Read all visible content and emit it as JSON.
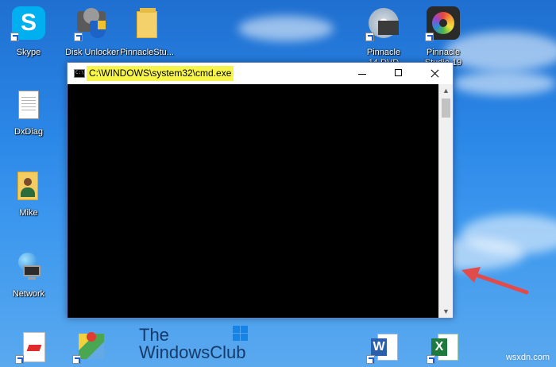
{
  "desktop": {
    "icons": [
      {
        "label": "Skype",
        "icon": "skype-icon"
      },
      {
        "label": "Disk Unlocker",
        "icon": "disk-unlocker-icon"
      },
      {
        "label": "PinnacleStu...",
        "icon": "folder-icon"
      },
      {
        "label": "Pinnacle\n14 DVD",
        "icon": "pinnacle-dvd-icon"
      },
      {
        "label": "Pinnacle\nStudio 19",
        "icon": "pinnacle-studio-icon"
      },
      {
        "label": "DxDiag",
        "icon": "document-icon"
      },
      {
        "label": "Mike",
        "icon": "user-folder-icon"
      },
      {
        "label": "Network",
        "icon": "network-icon"
      }
    ],
    "bottom_icons": [
      {
        "icon": "pdf-icon"
      },
      {
        "icon": "maps-icon"
      },
      {
        "icon": "word-icon"
      },
      {
        "icon": "excel-icon"
      }
    ]
  },
  "window": {
    "title": "C:\\WINDOWS\\system32\\cmd.exe",
    "controls": {
      "minimize": "minimize",
      "maximize": "maximize",
      "close": "close"
    }
  },
  "watermark": {
    "line1": "The",
    "line2": "WindowsClub",
    "site": "wsxdn.com"
  },
  "colors": {
    "highlight": "#f7f44a",
    "arrow": "#e34b4b"
  }
}
